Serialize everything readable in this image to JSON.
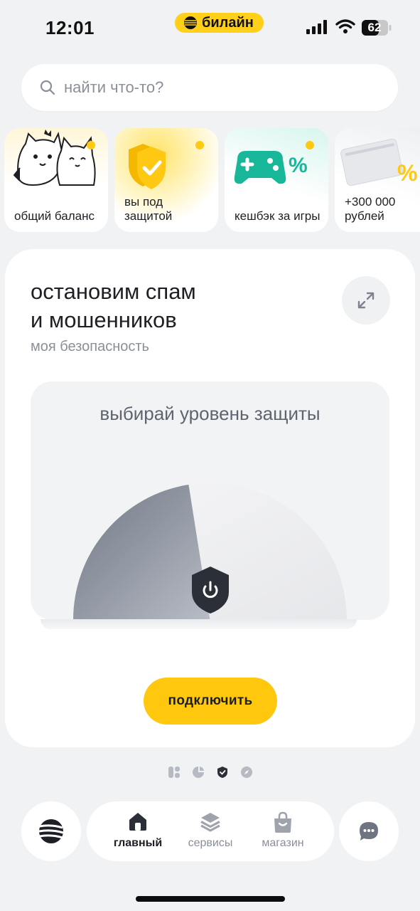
{
  "status_bar": {
    "time": "12:01",
    "carrier": "билайн",
    "battery": "62",
    "icons": [
      "signal-icon",
      "wifi-icon",
      "battery-icon"
    ]
  },
  "search": {
    "placeholder": "найти что-то?",
    "value": ""
  },
  "stories": [
    {
      "label": "общий баланс",
      "icon": "cats-illustration"
    },
    {
      "label": "вы под защитой",
      "icon": "shield-check-icon"
    },
    {
      "label": "кешбэк за игры",
      "icon": "gamepad-percent-icon"
    },
    {
      "label": "+300 000 рублей",
      "icon": "credit-card-percent-icon"
    }
  ],
  "main_card": {
    "title_line1": "остановим спам",
    "title_line2": "и мошенников",
    "subtitle": "моя безопасность",
    "level_title": "выбирай уровень защиты",
    "protection_level_fraction": 0.45,
    "connect_label": "подключить"
  },
  "pager": {
    "pages": 4,
    "active_index": 2
  },
  "bottom_nav": {
    "items": [
      {
        "label": "главный",
        "icon": "home-icon",
        "active": true
      },
      {
        "label": "сервисы",
        "icon": "layers-icon",
        "active": false
      },
      {
        "label": "магазин",
        "icon": "shopping-bag-icon",
        "active": false
      }
    ]
  },
  "colors": {
    "accent": "#ffc80f",
    "background": "#f1f2f4",
    "text": "#1d1f24",
    "muted": "#8a8f98",
    "gauge_fill": "#8a909c"
  }
}
